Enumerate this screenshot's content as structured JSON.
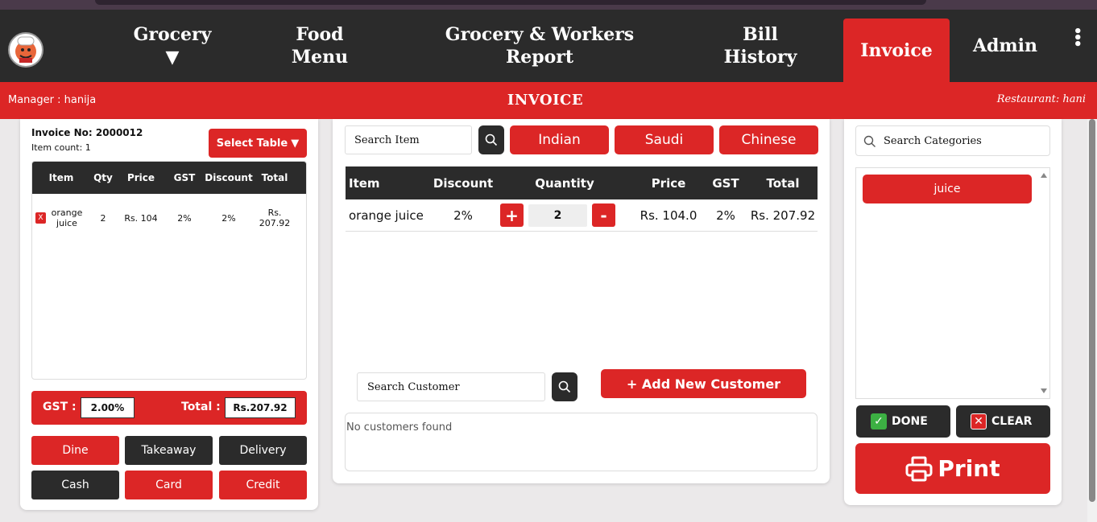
{
  "nav": {
    "items": [
      {
        "line1": "Grocery",
        "line2": "▼"
      },
      {
        "line1": "Food",
        "line2": "Menu"
      },
      {
        "line1": "Grocery & Workers",
        "line2": "Report"
      },
      {
        "line1": "Bill",
        "line2": "History"
      },
      {
        "line1": "Invoice",
        "line2": ""
      },
      {
        "line1": "Admin",
        "line2": ""
      }
    ],
    "kebab": "⋮"
  },
  "header": {
    "manager": "Manager : hanija",
    "title": "INVOICE",
    "restaurant": "Restaurant: hani"
  },
  "invoice": {
    "number_label": "Invoice No:",
    "number": "2000012",
    "item_count": "Item count: 1",
    "select_table": "Select Table",
    "select_arrow": "▼",
    "columns": [
      "Item",
      "Qty",
      "Price",
      "GST",
      "Discount",
      "Total"
    ],
    "rows": [
      {
        "remove": "X",
        "item": "orange juice",
        "qty": "2",
        "price": "Rs. 104",
        "gst": "2%",
        "discount": "2%",
        "total": "Rs. 207.92"
      }
    ],
    "gst_label": "GST :",
    "gst_value": "2.00%",
    "total_label": "Total :",
    "total_value": "Rs.207.92",
    "modes": [
      "Dine",
      "Takeaway",
      "Delivery",
      "Cash",
      "Card",
      "Credit"
    ]
  },
  "menu": {
    "search_placeholder": "Search Item",
    "categories": [
      "Indian",
      "Saudi",
      "Chinese"
    ],
    "columns": [
      "Item",
      "Discount",
      "Quantity",
      "Price",
      "GST",
      "Total"
    ],
    "rows": [
      {
        "item": "orange juice",
        "discount": "2%",
        "plus": "+",
        "qty": "2",
        "minus": "-",
        "price": "Rs. 104.0",
        "gst": "2%",
        "total": "Rs. 207.92"
      }
    ],
    "customer_search_placeholder": "Search Customer",
    "add_customer": "+ Add New Customer",
    "no_customers": "No customers found"
  },
  "sidebar": {
    "search_placeholder": "Search Categories",
    "categories": [
      "juice"
    ],
    "done": "DONE",
    "clear": "CLEAR",
    "print": "Print"
  },
  "colors": {
    "accent": "#dc2626",
    "dark": "#2b2b2b"
  }
}
